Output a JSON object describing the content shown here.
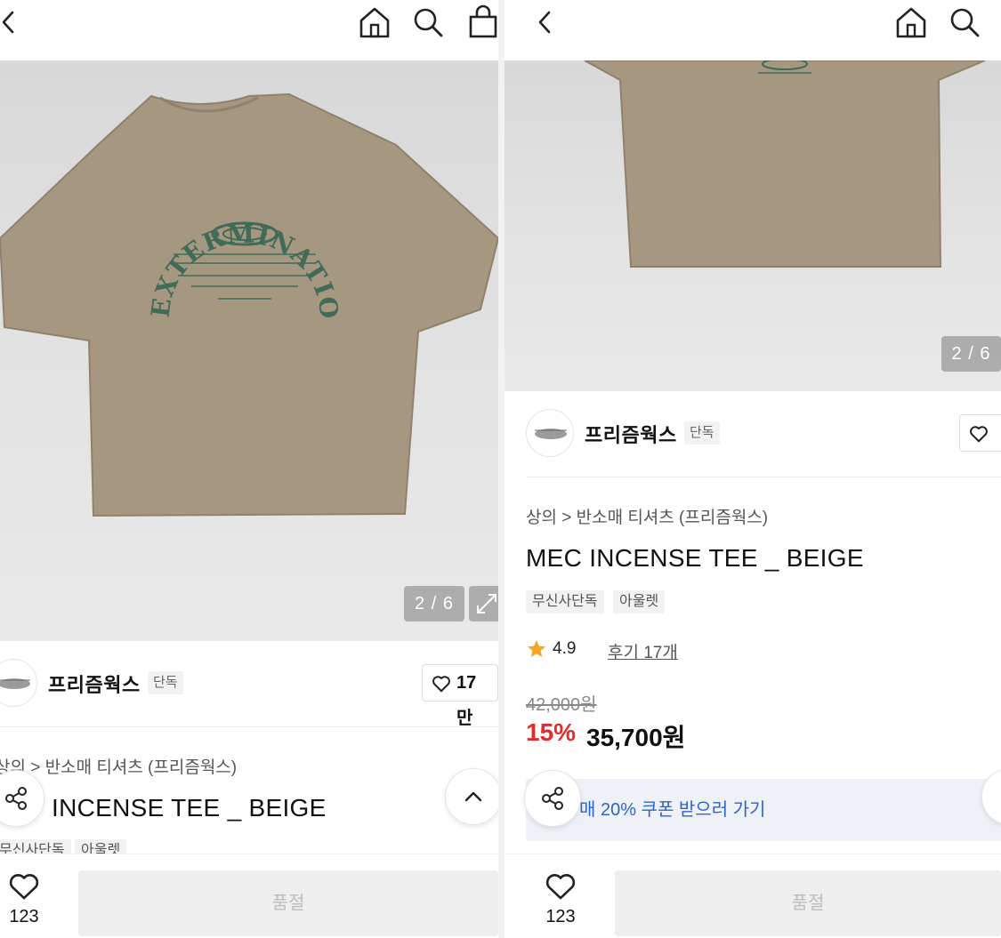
{
  "brand": {
    "name": "프리즘웍스",
    "exclusive_badge": "단독",
    "likes": "17만"
  },
  "image": {
    "counter": "2 / 6",
    "print_text": "EXTERMINATION"
  },
  "product": {
    "breadcrumb_left": "상의 > 반소매 티셔츠 (프리즘웍스)",
    "breadcrumb_right": "상의 > 반소매 티셔츠 (프리즘웍스)",
    "title_left": "INCENSE TEE _ BEIGE",
    "title_right": "MEC INCENSE TEE _ BEIGE",
    "tags_left": [
      "무신사단독",
      "아울렛"
    ],
    "tags_right": [
      "무신사단독",
      "아울렛"
    ],
    "rating": "4.9",
    "reviews": "후기 17개",
    "original_price": "42,000원",
    "discount": "15%",
    "price": "35,700원",
    "coupon": "매 20% 쿠폰 받으러 가기"
  },
  "bottom_bar": {
    "wish_count": "123",
    "sold_out_label": "품절"
  },
  "colors": {
    "discount_red": "#e22c2c",
    "coupon_blue": "#2f63c9",
    "shirt_beige": "#a69780",
    "print_green": "#3f6b57"
  },
  "icons": [
    "back-icon",
    "home-icon",
    "search-icon",
    "bag-icon",
    "heart-icon",
    "share-icon",
    "chevron-up-icon",
    "expand-icon",
    "star-icon"
  ]
}
